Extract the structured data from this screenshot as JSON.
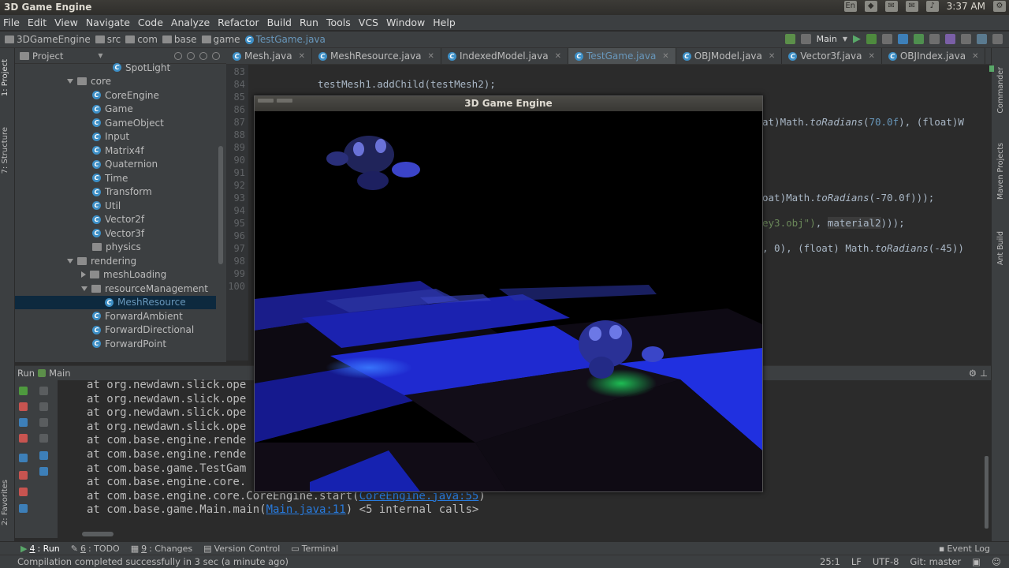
{
  "titlebar": {
    "title": "3D Game Engine",
    "tray": {
      "keyboard": "En",
      "time": "3:37 AM"
    }
  },
  "menubar": [
    "File",
    "Edit",
    "View",
    "Navigate",
    "Code",
    "Analyze",
    "Refactor",
    "Build",
    "Run",
    "Tools",
    "VCS",
    "Window",
    "Help"
  ],
  "breadcrumbs": [
    "3DGameEngine",
    "src",
    "com",
    "base",
    "game",
    "TestGame.java"
  ],
  "run_config": "Main",
  "project_panel": {
    "header": "Project",
    "tree": [
      {
        "label": "SpotLight",
        "kind": "class"
      },
      {
        "label": "core",
        "kind": "folder-open"
      },
      {
        "label": "CoreEngine",
        "kind": "class"
      },
      {
        "label": "Game",
        "kind": "class"
      },
      {
        "label": "GameObject",
        "kind": "class"
      },
      {
        "label": "Input",
        "kind": "class"
      },
      {
        "label": "Matrix4f",
        "kind": "class"
      },
      {
        "label": "Quaternion",
        "kind": "class"
      },
      {
        "label": "Time",
        "kind": "class"
      },
      {
        "label": "Transform",
        "kind": "class"
      },
      {
        "label": "Util",
        "kind": "class"
      },
      {
        "label": "Vector2f",
        "kind": "class"
      },
      {
        "label": "Vector3f",
        "kind": "class"
      },
      {
        "label": "physics",
        "kind": "folder"
      },
      {
        "label": "rendering",
        "kind": "folder-open"
      },
      {
        "label": "meshLoading",
        "kind": "folder-closed"
      },
      {
        "label": "resourceManagement",
        "kind": "folder-open"
      },
      {
        "label": "MeshResource",
        "kind": "class-selected"
      },
      {
        "label": "ForwardAmbient",
        "kind": "class"
      },
      {
        "label": "ForwardDirectional",
        "kind": "class"
      },
      {
        "label": "ForwardPoint",
        "kind": "class"
      }
    ]
  },
  "editor_tabs": [
    {
      "label": "Mesh.java",
      "active": false
    },
    {
      "label": "MeshResource.java",
      "active": false
    },
    {
      "label": "IndexedModel.java",
      "active": false
    },
    {
      "label": "TestGame.java",
      "active": true
    },
    {
      "label": "OBJModel.java",
      "active": false
    },
    {
      "label": "Vector3f.java",
      "active": false
    },
    {
      "label": "OBJIndex.java",
      "active": false
    }
  ],
  "line_numbers": [
    "83",
    "84",
    "85",
    "86",
    "87",
    "88",
    "89",
    "90",
    "91",
    "92",
    "93",
    "94",
    "95",
    "96",
    "97",
    "98",
    "99",
    "100"
  ],
  "code": {
    "line84": "testMesh1.addChild(testMesh2);",
    "line87_frag1": "at)Math.",
    "line87_fn": "toRadians",
    "line87_frag2": "(",
    "line87_num": "70.0f",
    "line87_frag3": "), (float)W",
    "line93_frag1": "oat)Math.",
    "line93_fn": "toRadians",
    "line93_frag2": "(-70.0f)));",
    "line95_str": "ey3.obj\")",
    "line95_frag": ", ",
    "line95_hl": "material2",
    "line95_end": ")));",
    "line97_frag1": ", 0), (float) Math.",
    "line97_fn": "toRadians",
    "line97_frag2": "(-45))"
  },
  "run_panel": {
    "header_run": "Run",
    "header_config": "Main",
    "console_lines": [
      "at org.newdawn.slick.ope",
      "at org.newdawn.slick.ope",
      "at org.newdawn.slick.ope",
      "at org.newdawn.slick.ope",
      "at com.base.engine.rende",
      "at com.base.engine.rende",
      "at com.base.game.TestGam",
      "at com.base.engine.core.",
      "at com.base.engine.core.CoreEngine.start(",
      "at com.base.game.Main.main("
    ],
    "partial_link": "CoreEngine.java:55",
    "partial_close": ")",
    "last_link": "Main.java:11",
    "last_suffix": ") <5 internal calls>"
  },
  "game_window": {
    "title": "3D Game Engine"
  },
  "bottom_tools": [
    {
      "num": "4",
      "label": ": Run"
    },
    {
      "num": "6",
      "label": ": TODO"
    },
    {
      "num": "9",
      "label": ": Changes"
    },
    {
      "num": "",
      "label": "Version Control"
    },
    {
      "num": "",
      "label": "Terminal"
    }
  ],
  "event_log": "Event Log",
  "left_vtabs": {
    "project": "1: Project",
    "structure": "7: Structure",
    "favorites": "2: Favorites"
  },
  "right_vtabs": {
    "commander": "Commander",
    "maven": "Maven Projects",
    "ant": "Ant Build"
  },
  "statusbar": {
    "message": "Compilation completed successfully in 3 sec (a minute ago)",
    "position": "25:1",
    "line_sep": "LF",
    "encoding": "UTF-8",
    "git": "Git: master"
  },
  "colors": {
    "accent": "#6897bb",
    "console_link": "#287bde",
    "selection": "#0d293e"
  }
}
